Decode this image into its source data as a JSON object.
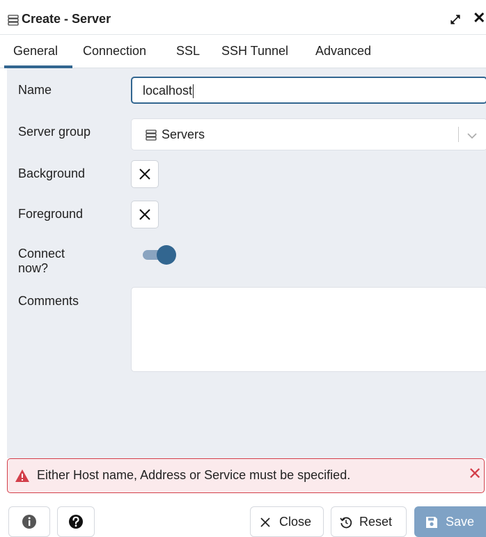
{
  "dialog": {
    "title": "Create - Server"
  },
  "tabs": [
    {
      "label": "General",
      "active": true
    },
    {
      "label": "Connection"
    },
    {
      "label": "SSL"
    },
    {
      "label": "SSH Tunnel"
    },
    {
      "label": "Advanced"
    }
  ],
  "form": {
    "name_label": "Name",
    "name_value": "localhost",
    "server_group_label": "Server group",
    "server_group_value": "Servers",
    "background_label": "Background",
    "foreground_label": "Foreground",
    "connect_now_label_line1": "Connect",
    "connect_now_label_line2": "now?",
    "connect_now_value": true,
    "comments_label": "Comments",
    "comments_value": ""
  },
  "alert": {
    "message": "Either Host name, Address or Service must be specified.",
    "close_glyph": "✕"
  },
  "footer": {
    "close_label": "Close",
    "reset_label": "Reset",
    "save_label": "Save"
  },
  "icons": {
    "title": "server-group-icon",
    "expand": "expand-icon",
    "close": "close-icon",
    "alert": "warning-icon",
    "info": "info-icon",
    "help": "help-icon"
  },
  "colors": {
    "accent": "#326690",
    "content_bg": "#ebeef3",
    "alert_bg": "#fbeaec",
    "alert_border": "#d33f4a",
    "save_bg": "#7fa2c5"
  }
}
